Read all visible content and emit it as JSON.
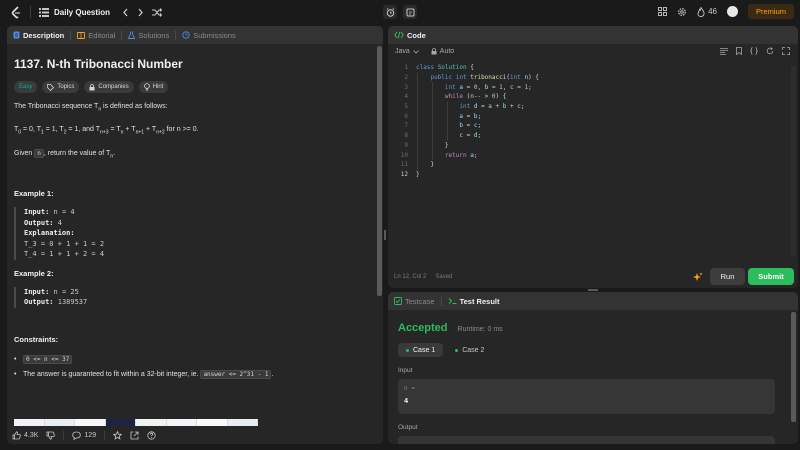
{
  "topbar": {
    "title": "Daily Question",
    "streak_count": "46",
    "premium_label": "Premium"
  },
  "description_panel": {
    "tabs": [
      {
        "label": "Description"
      },
      {
        "label": "Editorial"
      },
      {
        "label": "Solutions"
      },
      {
        "label": "Submissions"
      }
    ],
    "problem_title": "1137. N-th Tribonacci Number",
    "chips": {
      "difficulty": "Easy",
      "topics": "Topics",
      "companies": "Companies",
      "hint": "Hint"
    },
    "intro": "The Tribonacci sequence T",
    "intro_sub": "n",
    "intro_end": " is defined as follows:",
    "def_parts": [
      "T",
      "0",
      " = 0, T",
      "1",
      " = 1, T",
      "2",
      " = 1, and T",
      "n+3",
      " = T",
      "n",
      " + T",
      "n+1",
      " + T",
      "n+2",
      " for n >= 0."
    ],
    "given_pre": "Given ",
    "given_code": "n",
    "given_mid": ", return the value of T",
    "given_sub": "n",
    "given_end": ".",
    "example1": {
      "title": "Example 1:",
      "input_label": "Input:",
      "input_value": " n = 4",
      "output_label": "Output:",
      "output_value": " 4",
      "explanation_label": "Explanation:",
      "lines": [
        "T_3 = 0 + 1 + 1 = 2",
        "T_4 = 1 + 1 + 2 = 4"
      ]
    },
    "example2": {
      "title": "Example 2:",
      "input_label": "Input:",
      "input_value": " n = 25",
      "output_label": "Output:",
      "output_value": " 1389537"
    },
    "constraints_title": "Constraints:",
    "constraint1_code": "0 <= n <= 37",
    "constraint2_pre": "The answer is guaranteed to fit within a 32-bit integer, ie. ",
    "constraint2_code": "answer <= 2^31 - 1",
    "constraint2_end": ".",
    "footer": {
      "likes": "4.3K",
      "comments": "129"
    }
  },
  "code_panel": {
    "tab_label": "Code",
    "language": "Java",
    "auto_label": "Auto",
    "line_numbers": [
      "1",
      "2",
      "3",
      "4",
      "5",
      "6",
      "7",
      "8",
      "9",
      "10",
      "11",
      "12"
    ],
    "status_pos": "Ln 12, Col 2",
    "status_saved": "Saved",
    "run_label": "Run",
    "submit_label": "Submit"
  },
  "result_panel": {
    "tabs": [
      {
        "label": "Testcase"
      },
      {
        "label": "Test Result"
      }
    ],
    "status": "Accepted",
    "runtime": "Runtime: 0 ms",
    "cases": [
      {
        "label": "Case 1"
      },
      {
        "label": "Case 2"
      }
    ],
    "input_label": "Input",
    "input_var": "n =",
    "input_value": "4",
    "output_label": "Output"
  },
  "colors": {
    "accent_green": "#2cbb5d",
    "premium": "#ffa116",
    "easy": "#00b8a3"
  }
}
